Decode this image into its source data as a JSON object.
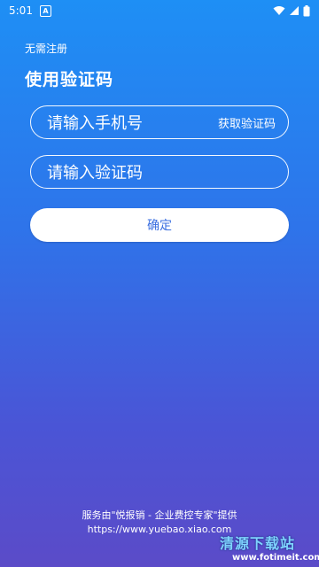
{
  "status_bar": {
    "time": "5:01",
    "badge": "A"
  },
  "header": {
    "skip_link": "无需注册",
    "title": "使用验证码"
  },
  "form": {
    "phone_placeholder": "请输入手机号",
    "get_code_label": "获取验证码",
    "code_placeholder": "请输入验证码",
    "confirm_label": "确定"
  },
  "footer": {
    "service_text": "服务由\"悦报销 - 企业费控专家\"提供",
    "url": "https://www.yuebao.xiao.com"
  },
  "watermark": {
    "title": "清源下载站",
    "url": "www.fotimeit.com"
  },
  "colors": {
    "gradient_top": "#1e8ff5",
    "gradient_bottom": "#5b4bc8",
    "button_text": "#3b6fe0"
  }
}
